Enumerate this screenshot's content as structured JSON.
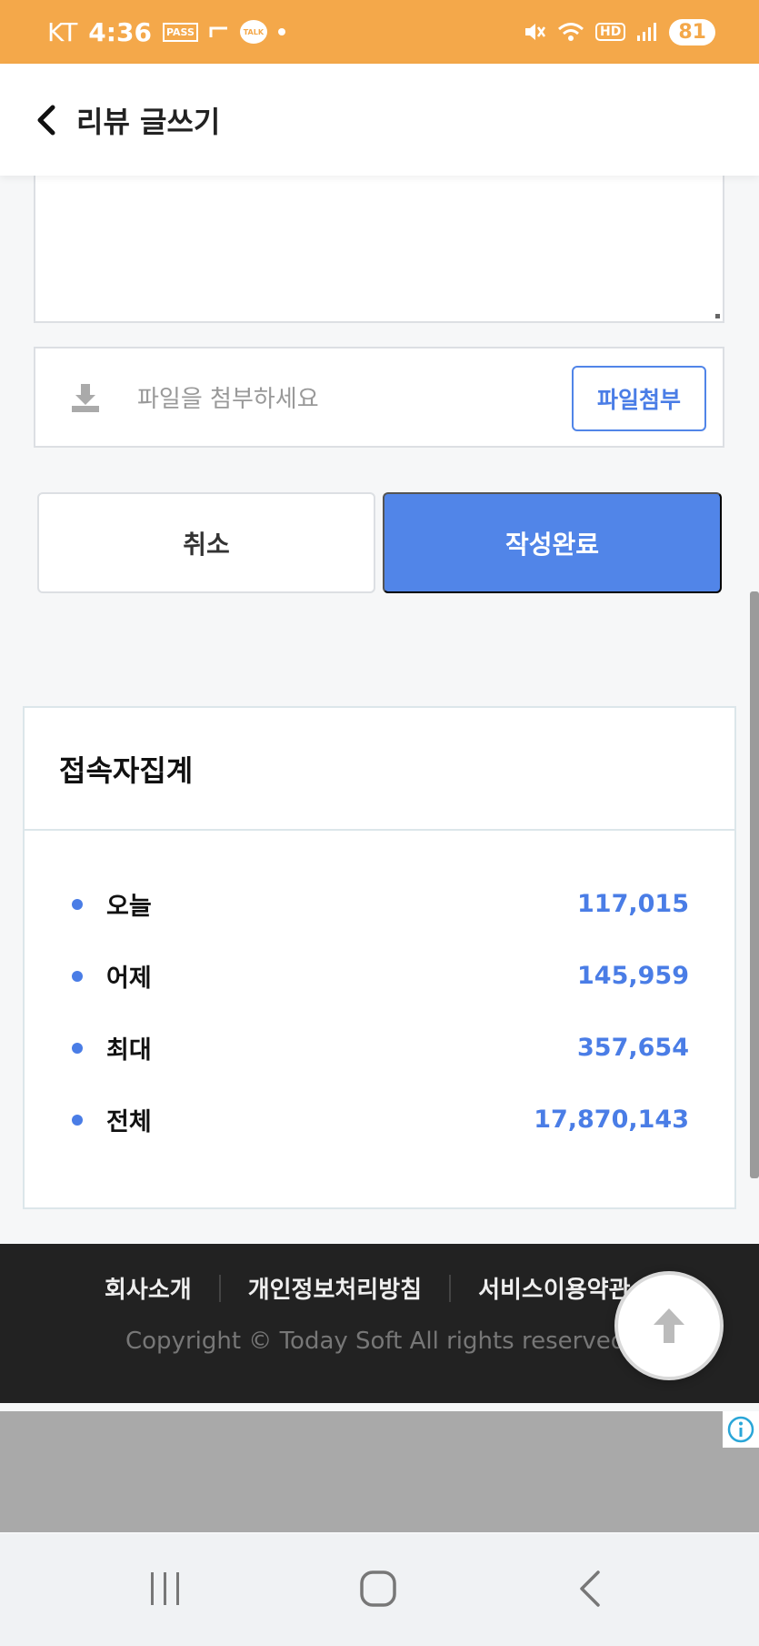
{
  "status_bar": {
    "carrier": "KT",
    "time": "4:36",
    "pass_label": "PASS",
    "talk_label": "TALK",
    "hd_label": "HD",
    "battery": "81"
  },
  "header": {
    "title": "리뷰 글쓰기",
    "back_icon": "chevron-left-icon"
  },
  "file_attach": {
    "placeholder": "파일을 첨부하세요",
    "button_label": "파일첨부",
    "icon": "download-icon"
  },
  "actions": {
    "cancel_label": "취소",
    "submit_label": "작성완료"
  },
  "visitor_stats": {
    "title": "접속자집계",
    "rows": [
      {
        "label": "오늘",
        "value": "117,015"
      },
      {
        "label": "어제",
        "value": "145,959"
      },
      {
        "label": "최대",
        "value": "357,654"
      },
      {
        "label": "전체",
        "value": "17,870,143"
      }
    ]
  },
  "footer": {
    "links": [
      "회사소개",
      "개인정보처리방침",
      "서비스이용약관"
    ],
    "copyright": "Copyright © Today Soft All rights reserved."
  },
  "colors": {
    "status_bar": "#f4a84a",
    "accent": "#5185e8",
    "footer_bg": "#222222",
    "ad_bg": "#a9a9a9"
  }
}
